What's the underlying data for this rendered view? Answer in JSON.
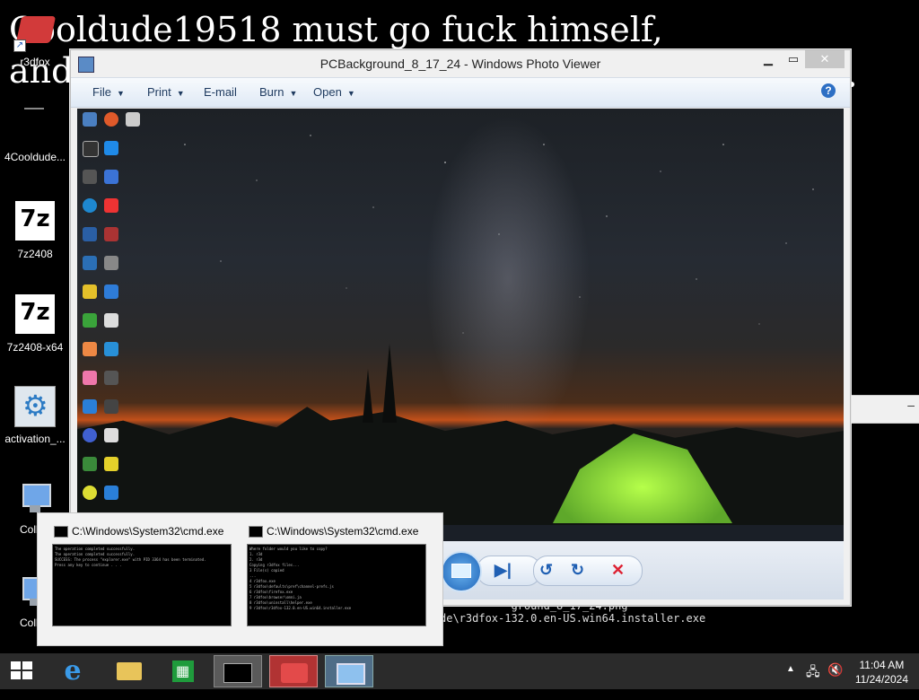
{
  "wallpaper": {
    "line1": "Cooldude19518 must go fuck himself,",
    "line2": "and"
  },
  "desktop_icons": [
    {
      "label": "r3dfox",
      "icon": "r3dfox-icon"
    },
    {
      "label": "4Cooldude...",
      "icon": "image-file-icon"
    },
    {
      "label": "7z2408",
      "icon": "7zip-icon"
    },
    {
      "label": "7z2408-x64",
      "icon": "7zip-icon"
    },
    {
      "label": "activation_...",
      "icon": "gear-settings-icon"
    },
    {
      "label": "Collab",
      "icon": "network-computer-icon"
    },
    {
      "label": "Collab",
      "icon": "network-computer-icon"
    }
  ],
  "photo_viewer": {
    "title": "PCBackground_8_17_24 - Windows Photo Viewer",
    "menu": {
      "file": "File",
      "print": "Print",
      "email": "E-mail",
      "burn": "Burn",
      "open": "Open"
    },
    "help": "?"
  },
  "console_behind": {
    "line1": "           ground_8_17_24.png",
    "line2": "de\\r3dfox-132.0.en-US.win64.installer.exe"
  },
  "thumbnails": [
    {
      "title": "C:\\Windows\\System32\\cmd.exe",
      "body": "The operation completed successfully.\nThe operation completed successfully.\nSUCCESS: The process \"explorer.exe\" with PID 3364 has been terminated.\nPress any key to continue . . ."
    },
    {
      "title": "C:\\Windows\\System32\\cmd.exe",
      "body": "Where folder would you like to copy?\n1. r3d\n2. r3d\nCopying r3dfox files...\n3 File(s) copied\n...\n4 r3dfox.exe\n5 r3dfox\\defaults\\pref\\channel-prefs.js\n6 r3dfox\\firefox.exe\n7 r3dfox\\browser\\omni.ja\n8 r3dfox\\uninstall\\helper.exe\n9 r3dfox\\r3dfox-132.0.en-US.win64.installer.exe"
    }
  ],
  "taskbar": {
    "items": [
      "start-button",
      "internet-explorer",
      "file-explorer",
      "windows-store",
      "cmd",
      "r3dfox",
      "photo-viewer"
    ]
  },
  "clock": {
    "time": "11:04 AM",
    "date": "11/24/2024"
  }
}
